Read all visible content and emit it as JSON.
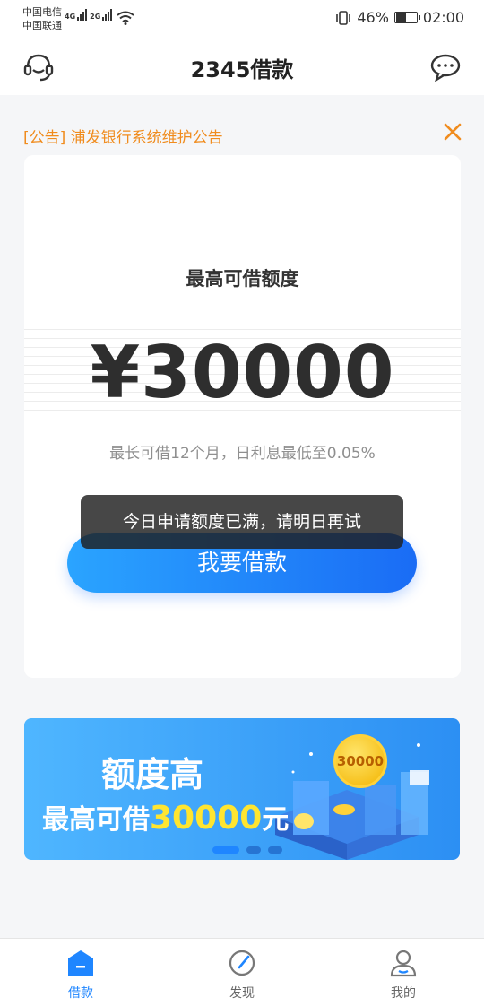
{
  "status_bar": {
    "carrier_1": "中国电信",
    "carrier_2": "中国联通",
    "net_1": "4G",
    "net_2": "2G",
    "battery": "46%",
    "time": "02:00"
  },
  "header": {
    "title": "2345借款",
    "left_icon": "customer-service-icon",
    "right_icon": "message-icon"
  },
  "notice": {
    "text": "[公告] 浦发银行系统维护公告",
    "close_icon": "close-icon",
    "color": "#f08c1e"
  },
  "card": {
    "label": "最高可借额度",
    "amount": "¥30000",
    "subtitle": "最长可借12个月，日利息最低至0.05%",
    "button": "我要借款"
  },
  "toast": {
    "text": "今日申请额度已满，请明日再试"
  },
  "banner": {
    "title": "额度高",
    "subtitle_prefix": "最高可借",
    "subtitle_amount": "30000",
    "subtitle_suffix": "元",
    "coin_text": "30000",
    "active_slide": 1,
    "slide_count": 3
  },
  "tabs": [
    {
      "label": "借款",
      "icon": "home-icon",
      "active": true
    },
    {
      "label": "发现",
      "icon": "compass-icon",
      "active": false
    },
    {
      "label": "我的",
      "icon": "user-icon",
      "active": false
    }
  ],
  "colors": {
    "accent": "#1f86ff",
    "notice": "#f08c1e",
    "highlight": "#ffe530"
  }
}
